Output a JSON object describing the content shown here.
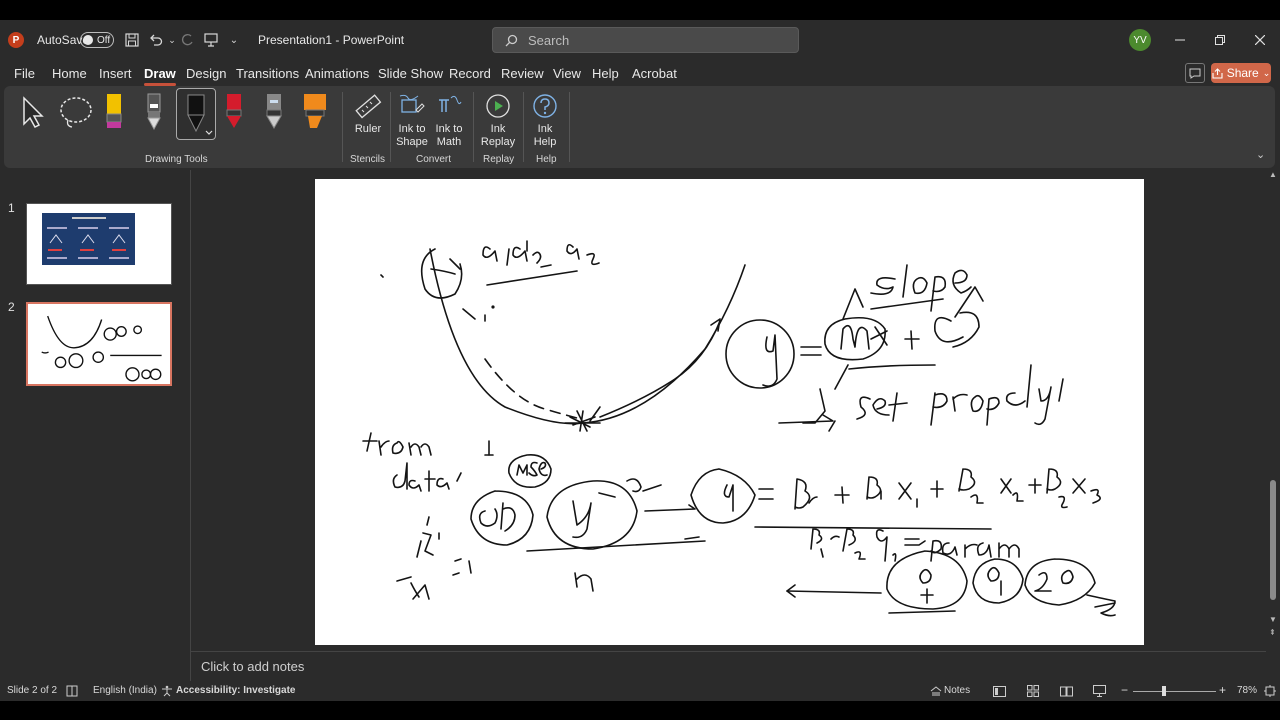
{
  "titlebar": {
    "autosave_label": "AutoSave",
    "autosave_state": "Off",
    "doc_title": "Presentation1  -  PowerPoint",
    "search_placeholder": "Search",
    "avatar_initials": "YV"
  },
  "menu": {
    "tabs": [
      "File",
      "Home",
      "Insert",
      "Draw",
      "Design",
      "Transitions",
      "Animations",
      "Slide Show",
      "Record",
      "Review",
      "View",
      "Help",
      "Acrobat"
    ],
    "active": "Draw",
    "share_label": "Share"
  },
  "ribbon": {
    "groups": {
      "drawing_tools": "Drawing Tools",
      "stencils": "Stencils",
      "convert": "Convert",
      "replay": "Replay",
      "help": "Help"
    },
    "buttons": {
      "ruler": "Ruler",
      "ink_to_shape_1": "Ink to",
      "ink_to_shape_2": "Shape",
      "ink_to_math_1": "Ink to",
      "ink_to_math_2": "Math",
      "ink_replay_1": "Ink",
      "ink_replay_2": "Replay",
      "ink_help_1": "Ink",
      "ink_help_2": "Help"
    },
    "pen_colors": [
      "#f2c100",
      "#222222",
      "#111111",
      "#d41c2c",
      "#888888",
      "#f08a1c"
    ]
  },
  "thumbnails": [
    {
      "number": "1"
    },
    {
      "number": "2"
    }
  ],
  "notes_placeholder": "Click to add notes",
  "status": {
    "slide_info": "Slide 2 of 2",
    "language": "English (India)",
    "accessibility": "Accessibility: Investigate",
    "notes_label": "Notes",
    "zoom": "78%"
  }
}
